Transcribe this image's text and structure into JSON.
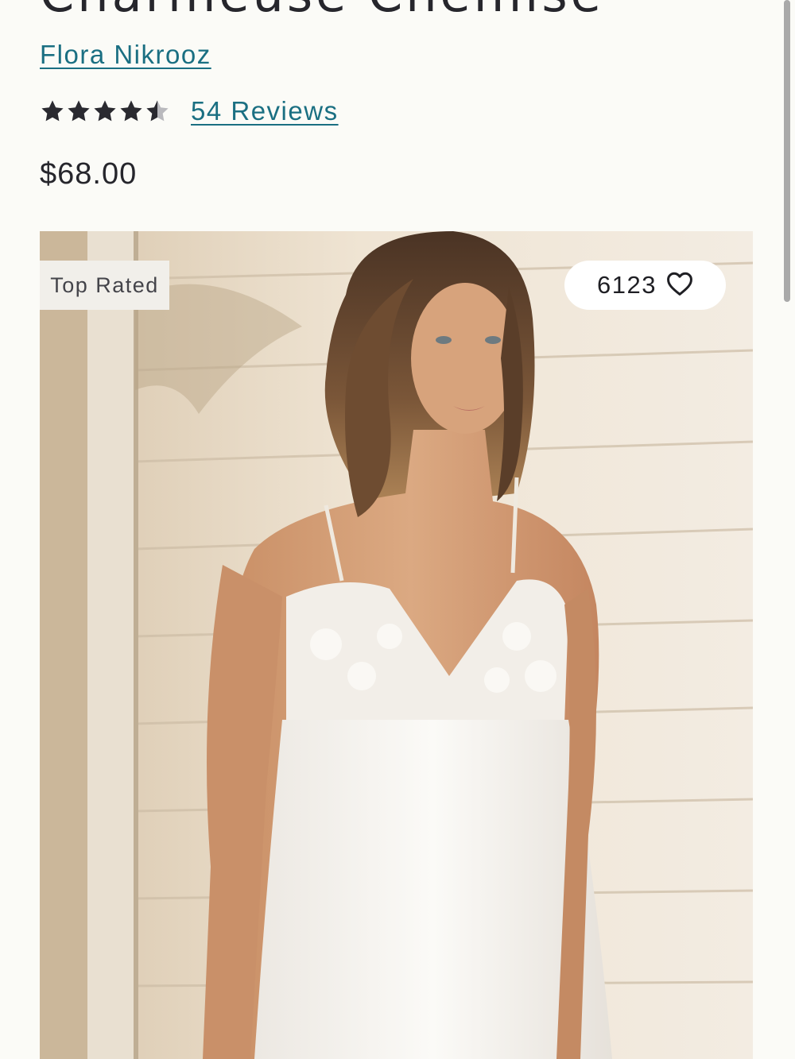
{
  "product": {
    "title": "Charmeuse Chemise",
    "brand": "Flora Nikrooz",
    "rating": {
      "value": 4.5,
      "max": 5,
      "reviews_label": "54 Reviews"
    },
    "price": "$68.00"
  },
  "image": {
    "badge": "Top Rated",
    "favorites_count": "6123",
    "favorite_icon": "heart-outline-icon"
  },
  "colors": {
    "link": "#1a6f82",
    "text": "#26262c",
    "background": "#fbfbf7",
    "star": "#2a2a30"
  }
}
